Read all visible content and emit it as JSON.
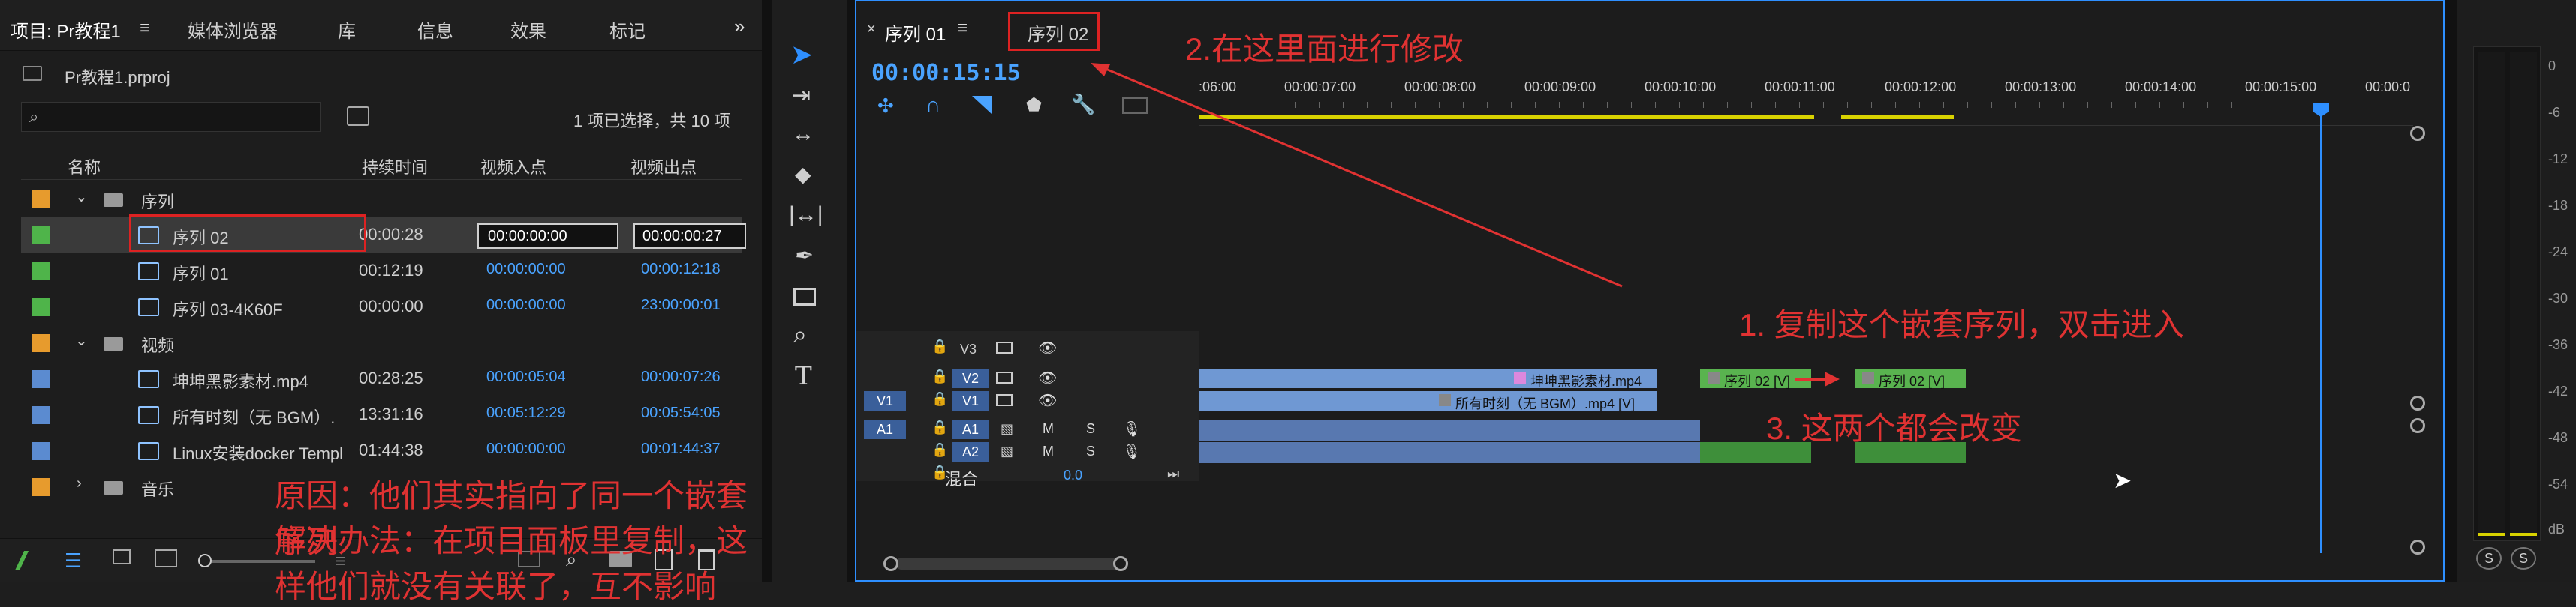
{
  "project_panel": {
    "tabs": [
      "项目: Pr教程1",
      "媒体浏览器",
      "库",
      "信息",
      "效果",
      "标记"
    ],
    "file_name": "Pr教程1.prproj",
    "selection_info": "1 项已选择，共 10 项",
    "columns": [
      "名称",
      "持续时间",
      "视频入点",
      "视频出点"
    ],
    "rows": [
      {
        "type": "folder",
        "name": "序列",
        "duration": "",
        "in": "",
        "out": "",
        "color": "#e79b2d"
      },
      {
        "type": "seq",
        "name": "序列 02",
        "duration": "00:00:28",
        "in": "00:00:00:00",
        "out": "00:00:00:27",
        "color": "#4fb44a",
        "selected": true
      },
      {
        "type": "seq",
        "name": "序列 01",
        "duration": "00:12:19",
        "in": "00:00:00:00",
        "out": "00:00:12:18",
        "color": "#4fb44a"
      },
      {
        "type": "seq",
        "name": "序列 03-4K60F",
        "duration": "00:00:00",
        "in": "00:00:00:00",
        "out": "23:00:00:01",
        "color": "#4fb44a"
      },
      {
        "type": "folder",
        "name": "视频",
        "duration": "",
        "in": "",
        "out": "",
        "color": "#e79b2d"
      },
      {
        "type": "clip",
        "name": "坤坤黑影素材.mp4",
        "duration": "00:28:25",
        "in": "00:00:05:04",
        "out": "00:00:07:26",
        "color": "#5b8bd0"
      },
      {
        "type": "clip",
        "name": "所有时刻（无 BGM）.",
        "duration": "13:31:16",
        "in": "00:05:12:29",
        "out": "00:05:54:05",
        "color": "#5b8bd0"
      },
      {
        "type": "clip",
        "name": "Linux安装docker Templ",
        "duration": "01:44:38",
        "in": "00:00:00:00",
        "out": "00:01:44:37",
        "color": "#5b8bd0"
      },
      {
        "type": "folder",
        "name": "音乐",
        "duration": "",
        "in": "",
        "out": "",
        "color": "#e79b2d"
      }
    ]
  },
  "timeline": {
    "tabs": [
      "序列 01",
      "序列 02"
    ],
    "timecode": "00:00:15:15",
    "ruler_labels": [
      ":06:00",
      "00:00:07:00",
      "00:00:08:00",
      "00:00:09:00",
      "00:00:10:00",
      "00:00:11:00",
      "00:00:12:00",
      "00:00:13:00",
      "00:00:14:00",
      "00:00:15:00",
      "00:00:0"
    ],
    "tracks": [
      "V3",
      "V2",
      "V1",
      "A1",
      "A2",
      "混合"
    ],
    "mix_value": "0.0",
    "src_labels": {
      "v1": "V1",
      "a1": "A1"
    },
    "clips": {
      "v2_main": "坤坤黑影素材.mp4 [V]",
      "v1_main": "所有时刻（无 BGM）.mp4 [V]",
      "seq_a": "序列 02 [V]",
      "seq_b": "序列 02 [V]"
    },
    "track_buttons": {
      "m": "M",
      "s": "S"
    }
  },
  "meter": {
    "scale": [
      "0",
      "-6",
      "-12",
      "-18",
      "-24",
      "-30",
      "-36",
      "-42",
      "-48",
      "-54",
      "dB"
    ],
    "buttons": [
      "S",
      "S"
    ]
  },
  "annotations": {
    "a1": "2.在这里面进行修改",
    "a2": "1. 复制这个嵌套序列，双击进入",
    "a3": "3. 这两个都会改变",
    "a4": "原因：他们其实指向了同一个嵌套序列",
    "a5": "解决办法：在项目面板里复制，这样他们就没有关联了，互不影响"
  },
  "colors": {
    "blue_play": "#2e8fff",
    "clip_blue": "#6f98d3",
    "clip_green": "#59b34f",
    "yellow": "#d8d200",
    "annot": "#e03232"
  }
}
